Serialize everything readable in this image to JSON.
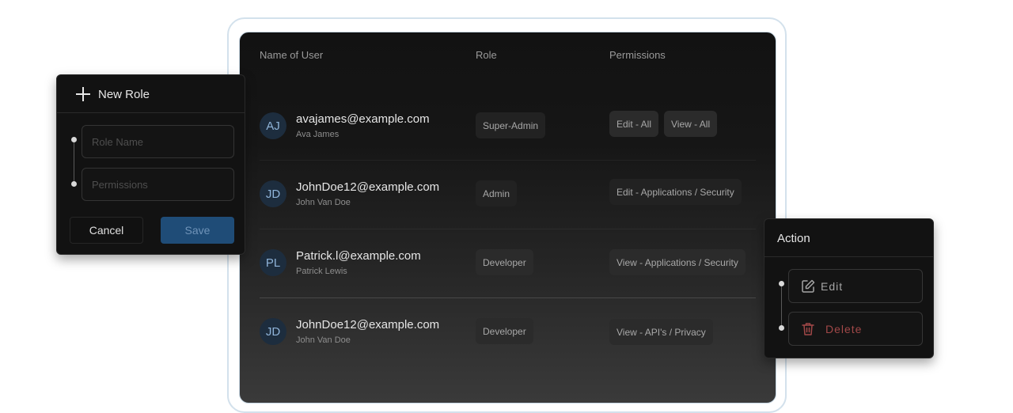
{
  "table": {
    "columns": [
      "Name of User",
      "Role",
      "Permissions"
    ],
    "rows": [
      {
        "initials": "AJ",
        "email": "avajames@example.com",
        "name": "Ava James",
        "role": "Super-Admin",
        "permissions": [
          "Edit - All",
          "View - All"
        ]
      },
      {
        "initials": "JD",
        "email": "JohnDoe12@example.com",
        "name": "John Van Doe",
        "role": "Admin",
        "permissions": [
          "Edit - Applications / Security"
        ]
      },
      {
        "initials": "PL",
        "email": "Patrick.l@example.com",
        "name": "Patrick Lewis",
        "role": "Developer",
        "permissions": [
          "View - Applications / Security"
        ]
      },
      {
        "initials": "JD",
        "email": "JohnDoe12@example.com",
        "name": "John Van Doe",
        "role": "Developer",
        "permissions": [
          "View - API's / Privacy"
        ]
      }
    ]
  },
  "new_role": {
    "title": "New Role",
    "role_name_placeholder": "Role Name",
    "permissions_placeholder": "Permissions",
    "cancel_label": "Cancel",
    "save_label": "Save"
  },
  "action_menu": {
    "title": "Action",
    "edit_label": "Edit",
    "delete_label": "Delete"
  },
  "icons": {
    "add": "plus-icon",
    "edit": "edit-icon",
    "delete": "trash-icon"
  },
  "colors": {
    "accent": "#1f4c77",
    "danger": "#a14848",
    "avatar_text": "#8fb4d9"
  }
}
